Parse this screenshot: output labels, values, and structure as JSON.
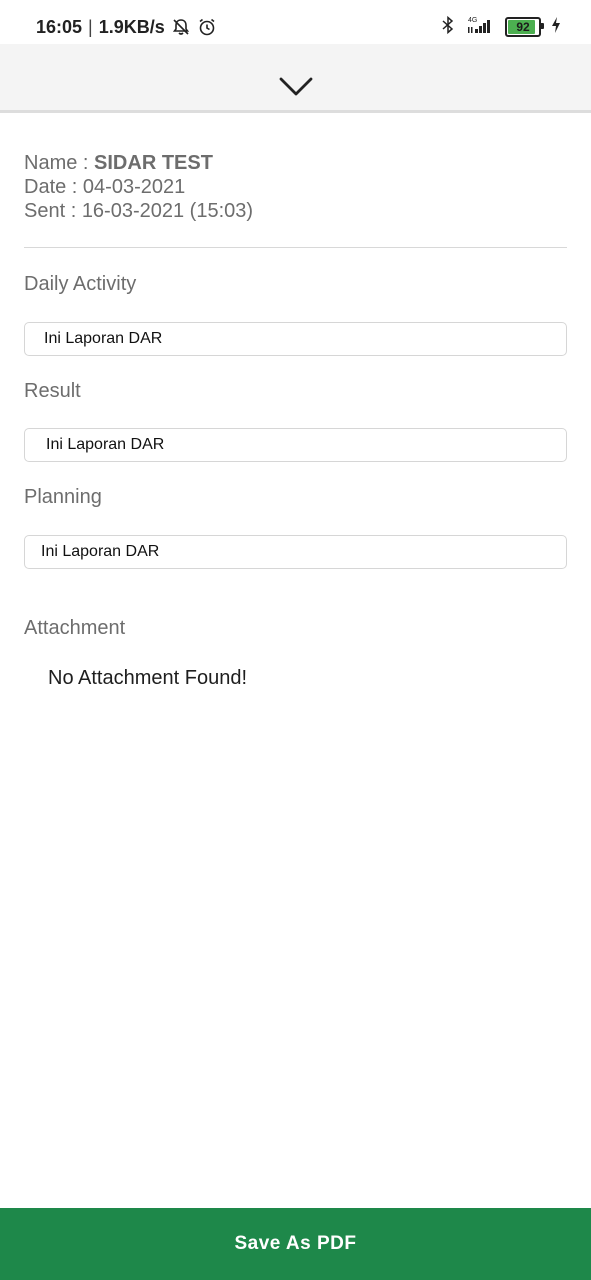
{
  "status_bar": {
    "time": "16:05",
    "separator": "|",
    "net_speed": "1.9KB/s",
    "icons": [
      "bell-off-icon",
      "alarm-icon",
      "bluetooth-icon",
      "signal-4g-icon",
      "battery-icon",
      "charging-icon"
    ],
    "network_label": "4G",
    "battery": {
      "level": 92,
      "label": "92",
      "color": "#4caf50"
    }
  },
  "header": {
    "collapse_icon": "chevron-down-icon"
  },
  "report": {
    "name_label": "Name : ",
    "name_value": "SIDAR TEST",
    "date_label": "Date : ",
    "date_value": "04-03-2021",
    "sent_label": "Sent : ",
    "sent_value": "16-03-2021 (15:03)"
  },
  "sections": {
    "daily_activity": {
      "label": "Daily Activity",
      "value": "Ini Laporan DAR"
    },
    "result": {
      "label": "Result",
      "value": "Ini Laporan DAR"
    },
    "planning": {
      "label": "Planning",
      "value": "Ini Laporan DAR"
    },
    "attachment": {
      "label": "Attachment",
      "empty_text": "No Attachment Found!"
    }
  },
  "footer": {
    "save_pdf_label": "Save As PDF"
  },
  "colors": {
    "accent_green": "#1e884a",
    "label_gray": "#6d6d6d"
  }
}
